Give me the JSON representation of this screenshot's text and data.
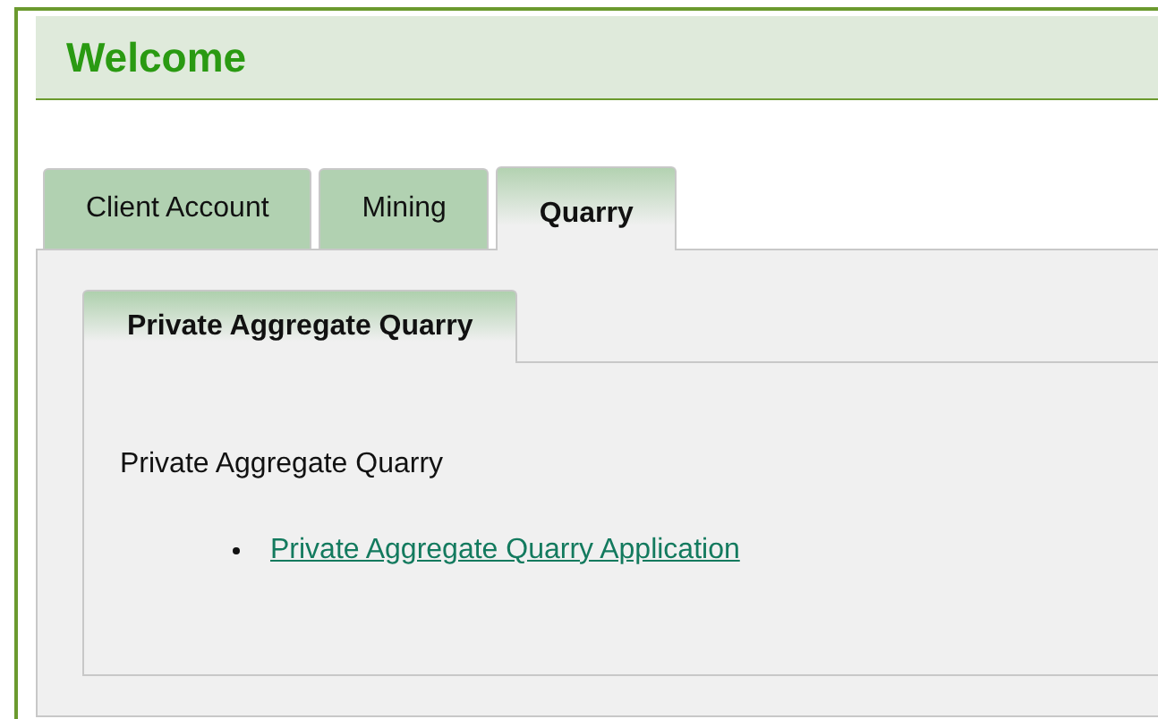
{
  "header": {
    "title": "Welcome"
  },
  "tabs": [
    {
      "label": "Client Account",
      "selected": false
    },
    {
      "label": "Mining",
      "selected": false
    },
    {
      "label": "Quarry",
      "selected": true
    }
  ],
  "sub_tabs": [
    {
      "label": "Private Aggregate Quarry",
      "selected": true
    }
  ],
  "content": {
    "heading": "Private Aggregate Quarry",
    "links": [
      "Private Aggregate Quarry Application"
    ]
  }
}
